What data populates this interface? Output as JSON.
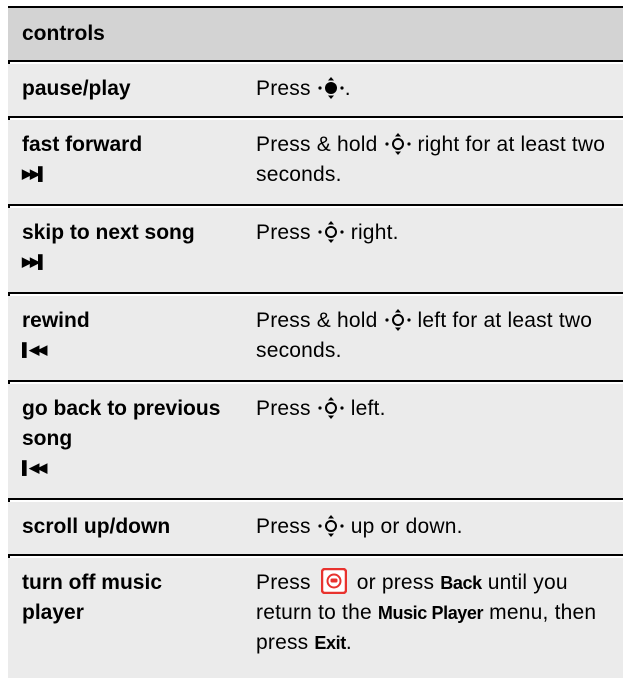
{
  "header": "controls",
  "rows": [
    {
      "feature": "pause/play",
      "symbol": "",
      "d1": "Press ",
      "d2": "."
    },
    {
      "feature": "fast forward",
      "symbol": "▶▶▌",
      "d1": "Press & hold ",
      "d2": " right for at least two seconds."
    },
    {
      "feature": "skip to next song",
      "symbol": "▶▶▌",
      "d1": "Press ",
      "d2": " right."
    },
    {
      "feature": "rewind",
      "symbol": "▌◀◀",
      "d1": "Press & hold ",
      "d2": " left for at least two seconds."
    },
    {
      "feature": "go back to previous song",
      "symbol": "▌◀◀",
      "d1": "Press ",
      "d2": " left."
    },
    {
      "feature": "scroll up/down",
      "symbol": "",
      "d1": "Press ",
      "d2": " up or down."
    },
    {
      "feature": "turn off music player",
      "d1": "Press ",
      "d2": " or press ",
      "back": "Back",
      "d3": " until you return to the ",
      "music_player": "Music Player",
      "d4": " menu, then press ",
      "exit": "Exit",
      "d5": "."
    }
  ],
  "icons": {
    "nav_center_select": "nav-key-center-icon",
    "nav_key": "nav-key-icon",
    "power_end_key": "power-end-key-icon",
    "power_key_color": "#e8322e"
  }
}
